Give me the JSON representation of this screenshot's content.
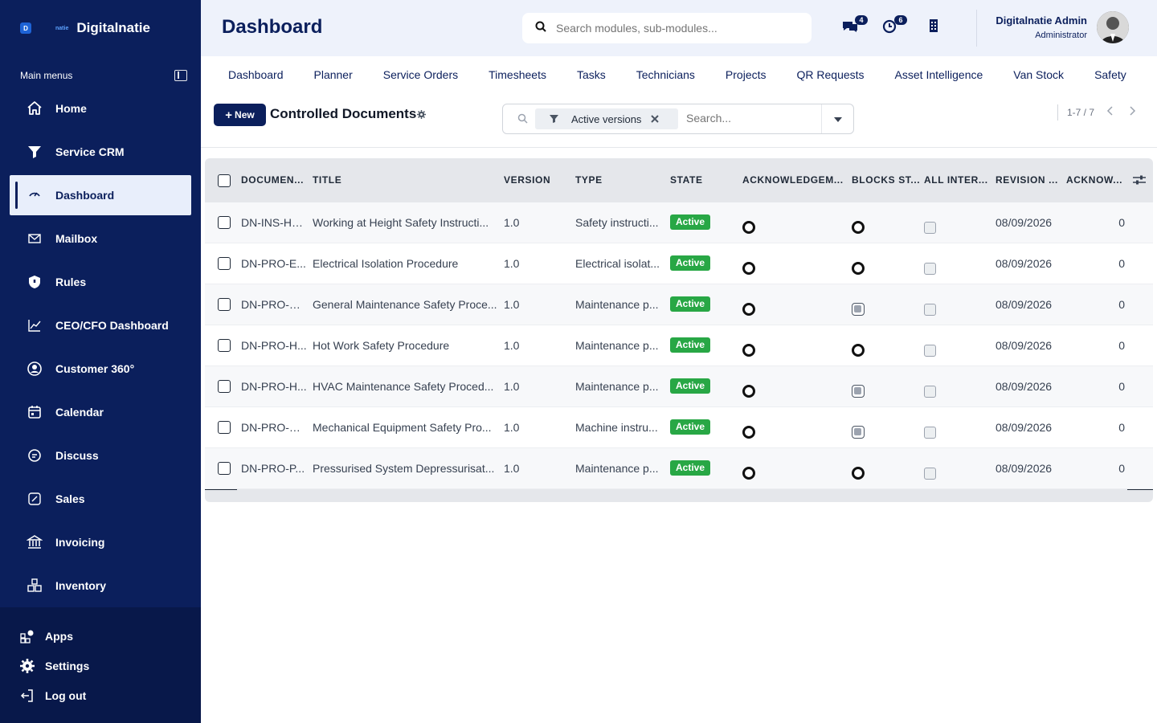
{
  "brand": {
    "logo_letter": "D",
    "small": "natie",
    "name": "Digitalnatie"
  },
  "sidebar": {
    "menus_label": "Main menus",
    "items": [
      {
        "label": "Home",
        "icon": "home-icon"
      },
      {
        "label": "Service CRM",
        "icon": "filter-icon"
      },
      {
        "label": "Dashboard",
        "icon": "gauge-icon",
        "active": true
      },
      {
        "label": "Mailbox",
        "icon": "mail-icon"
      },
      {
        "label": "Rules",
        "icon": "shield-icon"
      },
      {
        "label": "CEO/CFO Dashboard",
        "icon": "chart-line-icon"
      },
      {
        "label": "Customer 360°",
        "icon": "user-circle-icon"
      },
      {
        "label": "Calendar",
        "icon": "calendar-icon"
      },
      {
        "label": "Discuss",
        "icon": "chat-icon"
      },
      {
        "label": "Sales",
        "icon": "percent-icon"
      },
      {
        "label": "Invoicing",
        "icon": "bank-icon"
      },
      {
        "label": "Inventory",
        "icon": "boxes-icon"
      }
    ],
    "bottom": {
      "apps": "Apps",
      "settings": "Settings",
      "logout": "Log out"
    }
  },
  "topbar": {
    "title": "Dashboard",
    "search_placeholder": "Search modules, sub-modules...",
    "messages_badge": "4",
    "activity_badge": "6",
    "user_name": "Digitalnatie Admin",
    "user_role": "Administrator"
  },
  "module_tabs": [
    "Dashboard",
    "Planner",
    "Service Orders",
    "Timesheets",
    "Tasks",
    "Technicians",
    "Projects",
    "QR Requests",
    "Asset Intelligence",
    "Van Stock",
    "Safety"
  ],
  "control": {
    "new_label": "New",
    "list_title": "Controlled Documents",
    "filter_chip": "Active versions",
    "search_placeholder": "Search...",
    "pager": "1-7 / 7"
  },
  "table": {
    "headers": [
      "DOCUMEN...",
      "TITLE",
      "VERSION",
      "TYPE",
      "STATE",
      "ACKNOWLEDGEM...",
      "BLOCKS ST...",
      "ALL INTER...",
      "REVISION ...",
      "ACKNOW..."
    ],
    "rows": [
      {
        "doc": "DN-INS-HE...",
        "title": "Working at Height Safety Instructi...",
        "version": "1.0",
        "type": "Safety instructi...",
        "state": "Active",
        "blocks": "ring",
        "revision": "08/09/2026",
        "ack": "0"
      },
      {
        "doc": "DN-PRO-E...",
        "title": "Electrical Isolation Procedure",
        "version": "1.0",
        "type": "Electrical isolat...",
        "state": "Active",
        "blocks": "ring",
        "revision": "08/09/2026",
        "ack": "0"
      },
      {
        "doc": "DN-PRO-G...",
        "title": "General Maintenance Safety Proce...",
        "version": "1.0",
        "type": "Maintenance p...",
        "state": "Active",
        "blocks": "filled",
        "revision": "08/09/2026",
        "ack": "0"
      },
      {
        "doc": "DN-PRO-H...",
        "title": "Hot Work Safety Procedure",
        "version": "1.0",
        "type": "Maintenance p...",
        "state": "Active",
        "blocks": "ring",
        "revision": "08/09/2026",
        "ack": "0"
      },
      {
        "doc": "DN-PRO-H...",
        "title": "HVAC Maintenance Safety Proced...",
        "version": "1.0",
        "type": "Maintenance p...",
        "state": "Active",
        "blocks": "filled",
        "revision": "08/09/2026",
        "ack": "0"
      },
      {
        "doc": "DN-PRO-M...",
        "title": "Mechanical Equipment Safety Pro...",
        "version": "1.0",
        "type": "Machine instru...",
        "state": "Active",
        "blocks": "filled",
        "revision": "08/09/2026",
        "ack": "0"
      },
      {
        "doc": "DN-PRO-P...",
        "title": "Pressurised System Depressurisat...",
        "version": "1.0",
        "type": "Maintenance p...",
        "state": "Active",
        "blocks": "ring",
        "revision": "08/09/2026",
        "ack": "0"
      }
    ]
  },
  "colors": {
    "sidebar": "#0b1f5c",
    "accent": "#0b1f5c",
    "active_badge": "#28a745",
    "topbar": "#eef2fb"
  }
}
